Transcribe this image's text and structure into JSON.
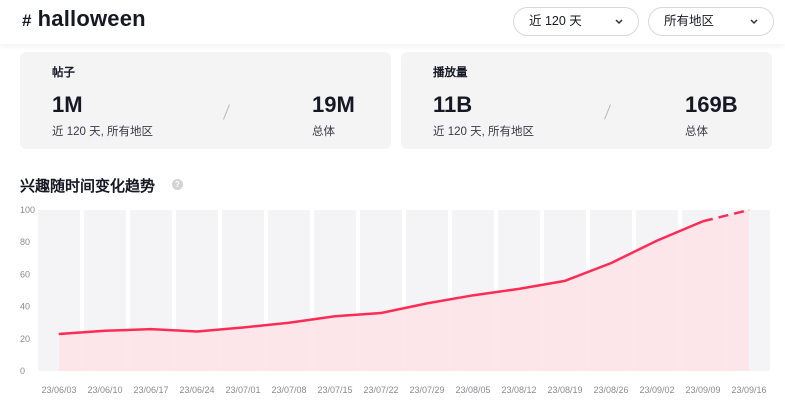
{
  "header": {
    "hash_symbol": "#",
    "hashtag": "halloween",
    "range_select": "近 120 天",
    "region_select": "所有地区",
    "chevron_icon": "chevron-down-icon"
  },
  "cards": [
    {
      "label": "帖子",
      "recent_value": "1M",
      "recent_caption": "近 120 天, 所有地区",
      "total_value": "19M",
      "total_caption": "总体"
    },
    {
      "label": "播放量",
      "recent_value": "11B",
      "recent_caption": "近 120 天, 所有地区",
      "total_value": "169B",
      "total_caption": "总体"
    }
  ],
  "section": {
    "title": "兴趣随时间变化趋势",
    "help_icon": "question-circle-icon"
  },
  "chart_data": {
    "type": "area",
    "title": "",
    "xlabel": "",
    "ylabel": "",
    "ylim": [
      0,
      100
    ],
    "yticks": [
      0,
      20,
      40,
      60,
      80,
      100
    ],
    "grid": "vertical bands",
    "line_color": "#fe2c55",
    "fill_color": "#fde3e8",
    "band_color": "#f4f4f6",
    "categories": [
      "23/06/03",
      "23/06/10",
      "23/06/17",
      "23/06/24",
      "23/07/01",
      "23/07/08",
      "23/07/15",
      "23/07/22",
      "23/07/29",
      "23/08/05",
      "23/08/12",
      "23/08/19",
      "23/08/26",
      "23/09/02",
      "23/09/09",
      "23/09/16"
    ],
    "values": [
      23,
      25,
      26,
      24.5,
      27,
      30,
      34,
      36,
      42,
      47,
      51,
      56,
      67,
      81,
      93,
      100
    ],
    "dashed_last_segment": true
  }
}
